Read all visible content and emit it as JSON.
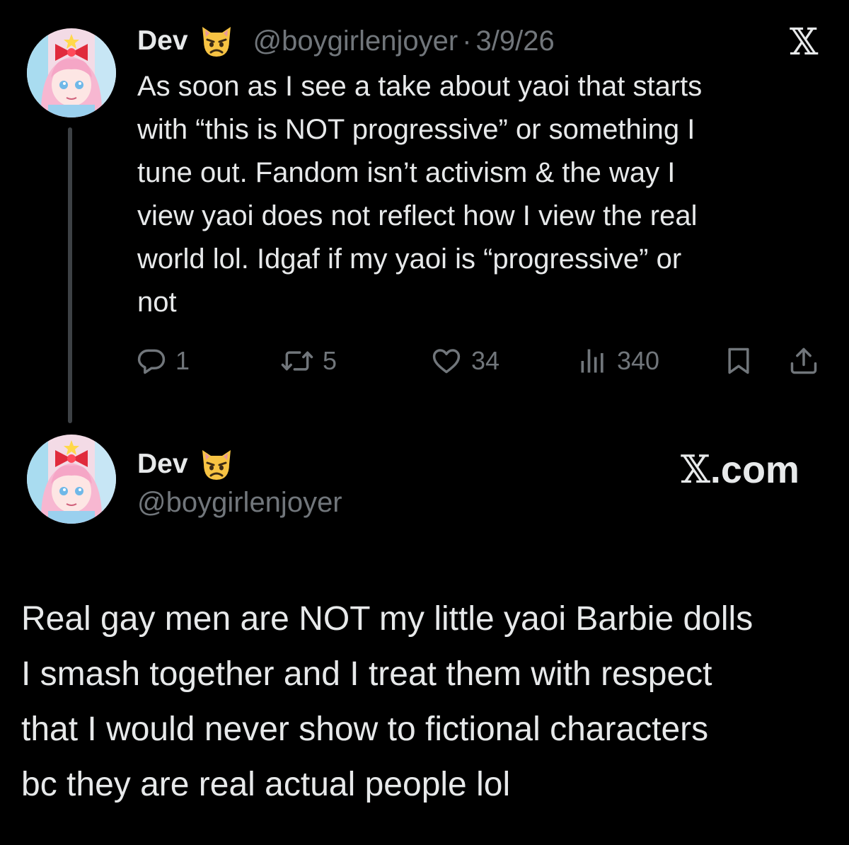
{
  "colors": {
    "background": "#000000",
    "primary_text": "#e7e9ea",
    "secondary_text": "#71767b",
    "thread_line": "#3d4145"
  },
  "tweet": {
    "author_name": "Dev",
    "author_emoji": "pouting-cat-face",
    "handle": "@boygirlenjoyer",
    "separator": "·",
    "date": "3/9/26",
    "text": "As soon as I see a take about yaoi that starts\nwith “this is NOT progressive” or something I\ntune out. Fandom isn’t activism & the way I\nview yaoi does not reflect how I view the real\nworld lol. Idgaf if my yaoi is “progressive” or\nnot",
    "actions": {
      "reply_icon": "reply-icon",
      "reply_count": "1",
      "repost_icon": "repost-icon",
      "repost_count": "5",
      "like_icon": "heart-icon",
      "like_count": "34",
      "views_icon": "views-icon",
      "views_count": "340",
      "bookmark_icon": "bookmark-icon",
      "share_icon": "share-icon"
    },
    "logo": "𝕏"
  },
  "card": {
    "author_name": "Dev",
    "author_emoji": "pouting-cat-face",
    "handle": "@boygirlenjoyer",
    "brand_mark": "𝕏",
    "brand_suffix": ".com",
    "text": "Real gay men are NOT my little yaoi Barbie dolls\nI smash together and I treat them with respect\nthat I would never show to fictional characters\nbc they are real actual people lol"
  }
}
